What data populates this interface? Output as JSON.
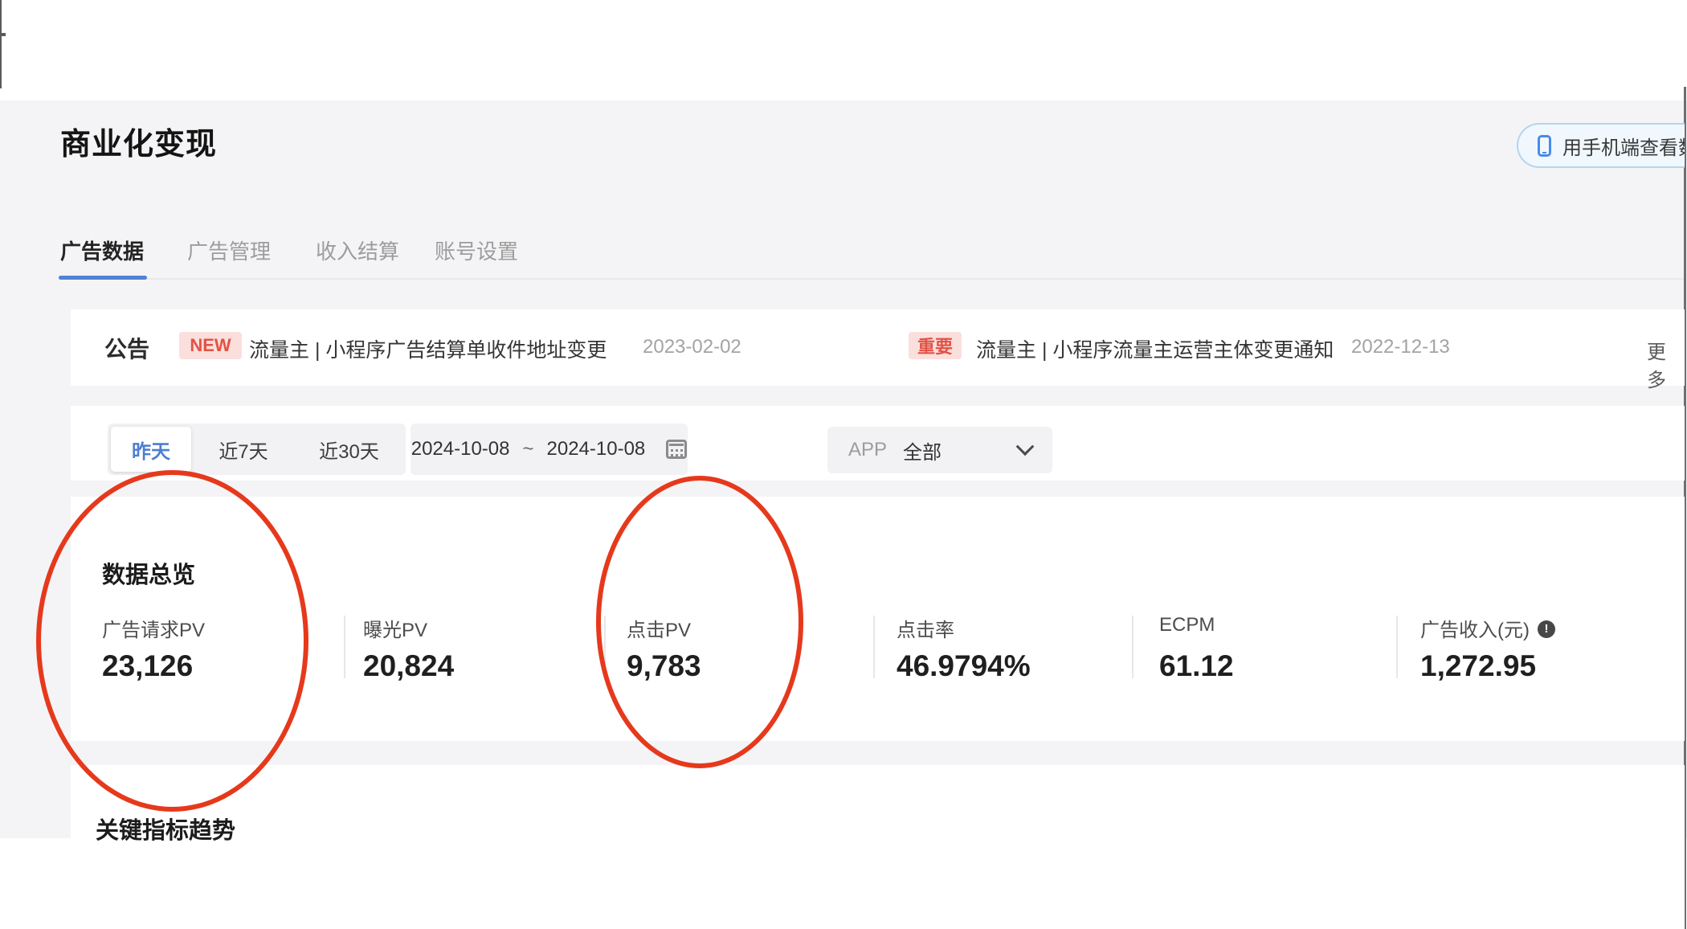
{
  "page_title": "商业化变现",
  "header": {
    "mobile_view_button": {
      "icon": "phone-icon",
      "label": "用手机端查看数据"
    }
  },
  "tabs": [
    {
      "label": "广告数据",
      "active": true
    },
    {
      "label": "广告管理",
      "active": false
    },
    {
      "label": "收入结算",
      "active": false
    },
    {
      "label": "账号设置",
      "active": false
    }
  ],
  "announcement": {
    "title": "公告",
    "items": [
      {
        "badge": "NEW",
        "text": "流量主 | 小程序广告结算单收件地址变更",
        "date": "2023-02-02"
      },
      {
        "badge": "重要",
        "text": "流量主 | 小程序流量主运营主体变更通知",
        "date": "2022-12-13"
      }
    ],
    "more_label": "更多"
  },
  "filters": {
    "quick_ranges": [
      {
        "label": "昨天",
        "selected": true
      },
      {
        "label": "近7天",
        "selected": false
      },
      {
        "label": "近30天",
        "selected": false
      }
    ],
    "date_range": {
      "start": "2024-10-08",
      "separator": "~",
      "end": "2024-10-08",
      "icon": "calendar-icon"
    },
    "app_select": {
      "label": "APP",
      "value": "全部",
      "icon": "chevron-down-icon"
    }
  },
  "overview": {
    "title": "数据总览",
    "metrics": [
      {
        "label": "广告请求PV",
        "value": "23,126"
      },
      {
        "label": "曝光PV",
        "value": "20,824"
      },
      {
        "label": "点击PV",
        "value": "9,783"
      },
      {
        "label": "点击率",
        "value": "46.9794%"
      },
      {
        "label": "ECPM",
        "value": "61.12"
      },
      {
        "label": "广告收入(元)",
        "value": "1,272.95",
        "info": "info-icon"
      }
    ]
  },
  "trend": {
    "title": "关键指标趋势"
  },
  "annotations": {
    "circled_metrics": [
      "广告请求PV",
      "点击PV"
    ],
    "color": "#e6391c"
  },
  "colors": {
    "page_bg": "#f4f4f6",
    "accent_blue": "#4d7ed2",
    "badge_red": "#e25245",
    "annotation_red": "#e6391c"
  }
}
